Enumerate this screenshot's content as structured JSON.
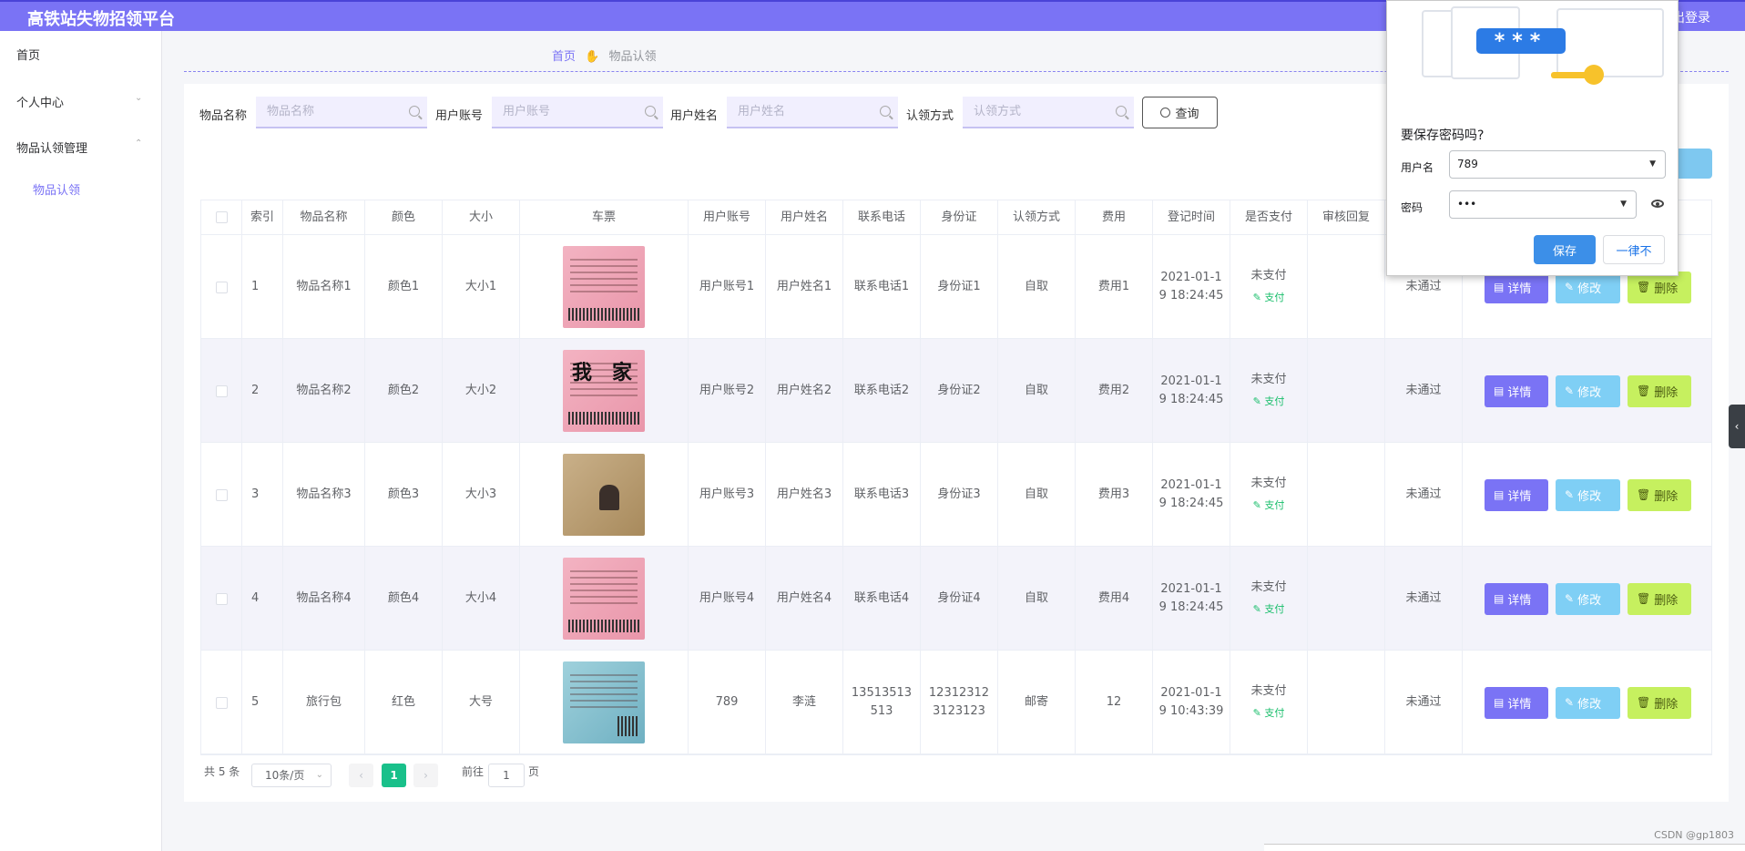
{
  "app": {
    "title": "高铁站失物招领平台",
    "logout": "退出登录"
  },
  "sidebar": {
    "items": [
      {
        "label": "首页"
      },
      {
        "label": "个人中心"
      },
      {
        "label": "物品认领管理"
      }
    ],
    "sub_items": [
      {
        "label": "物品认领"
      }
    ]
  },
  "breadcrumb": {
    "home": "首页",
    "current": "物品认领"
  },
  "search": {
    "fields": [
      {
        "label": "物品名称",
        "placeholder": "物品名称"
      },
      {
        "label": "用户账号",
        "placeholder": "用户账号"
      },
      {
        "label": "用户姓名",
        "placeholder": "用户姓名"
      },
      {
        "label": "认领方式",
        "placeholder": "认领方式"
      }
    ],
    "query_label": "查询"
  },
  "table": {
    "headers": [
      "索引",
      "物品名称",
      "颜色",
      "大小",
      "车票",
      "用户账号",
      "用户姓名",
      "联系电话",
      "身份证",
      "认领方式",
      "费用",
      "登记时间",
      "是否支付",
      "审核回复"
    ],
    "pay_action": "支付",
    "actions": {
      "detail": "详情",
      "edit": "修改",
      "delete": "删除"
    },
    "rows": [
      {
        "index": "1",
        "name": "物品名称1",
        "color": "颜色1",
        "size": "大小1",
        "ticket": "pink-ticket",
        "account": "用户账号1",
        "username": "用户姓名1",
        "phone": "联系电话1",
        "idcard": "身份证1",
        "method": "自取",
        "fee": "费用1",
        "time": "2021-01-1\n9 18:24:45",
        "paid": "未支付",
        "reply": "",
        "status": "未通过"
      },
      {
        "index": "2",
        "name": "物品名称2",
        "color": "颜色2",
        "size": "大小2",
        "ticket": "pink-ticket-wojia",
        "account": "用户账号2",
        "username": "用户姓名2",
        "phone": "联系电话2",
        "idcard": "身份证2",
        "method": "自取",
        "fee": "费用2",
        "time": "2021-01-1\n9 18:24:45",
        "paid": "未支付",
        "reply": "",
        "status": "未通过"
      },
      {
        "index": "3",
        "name": "物品名称3",
        "color": "颜色3",
        "size": "大小3",
        "ticket": "id-card-photo",
        "account": "用户账号3",
        "username": "用户姓名3",
        "phone": "联系电话3",
        "idcard": "身份证3",
        "method": "自取",
        "fee": "费用3",
        "time": "2021-01-1\n9 18:24:45",
        "paid": "未支付",
        "reply": "",
        "status": "未通过"
      },
      {
        "index": "4",
        "name": "物品名称4",
        "color": "颜色4",
        "size": "大小4",
        "ticket": "pink-ticket",
        "account": "用户账号4",
        "username": "用户姓名4",
        "phone": "联系电话4",
        "idcard": "身份证4",
        "method": "自取",
        "fee": "费用4",
        "time": "2021-01-1\n9 18:24:45",
        "paid": "未支付",
        "reply": "",
        "status": "未通过"
      },
      {
        "index": "5",
        "name": "旅行包",
        "color": "红色",
        "size": "大号",
        "ticket": "blue-ticket",
        "account": "789",
        "username": "李涟",
        "phone": "13513513\n513",
        "idcard": "12312312\n3123123",
        "method": "邮寄",
        "fee": "12",
        "time": "2021-01-1\n9 10:43:39",
        "paid": "未支付",
        "reply": "",
        "status": "未通过"
      }
    ]
  },
  "pagination": {
    "total": "共 5 条",
    "page_size": "10条/页",
    "current": "1",
    "goto_prefix": "前往",
    "goto_value": "1",
    "goto_suffix": "页"
  },
  "password_dialog": {
    "title": "要保存密码吗?",
    "username_label": "用户名",
    "username_value": "789",
    "password_label": "密码",
    "password_value": "•••",
    "save": "保存",
    "never": "一律不",
    "stars": "***"
  },
  "watermark": "CSDN @gp1803",
  "colors": {
    "accent": "#7a73f5",
    "success": "#19c08a",
    "edit": "#7fcff5",
    "delete": "#c6f05f"
  }
}
